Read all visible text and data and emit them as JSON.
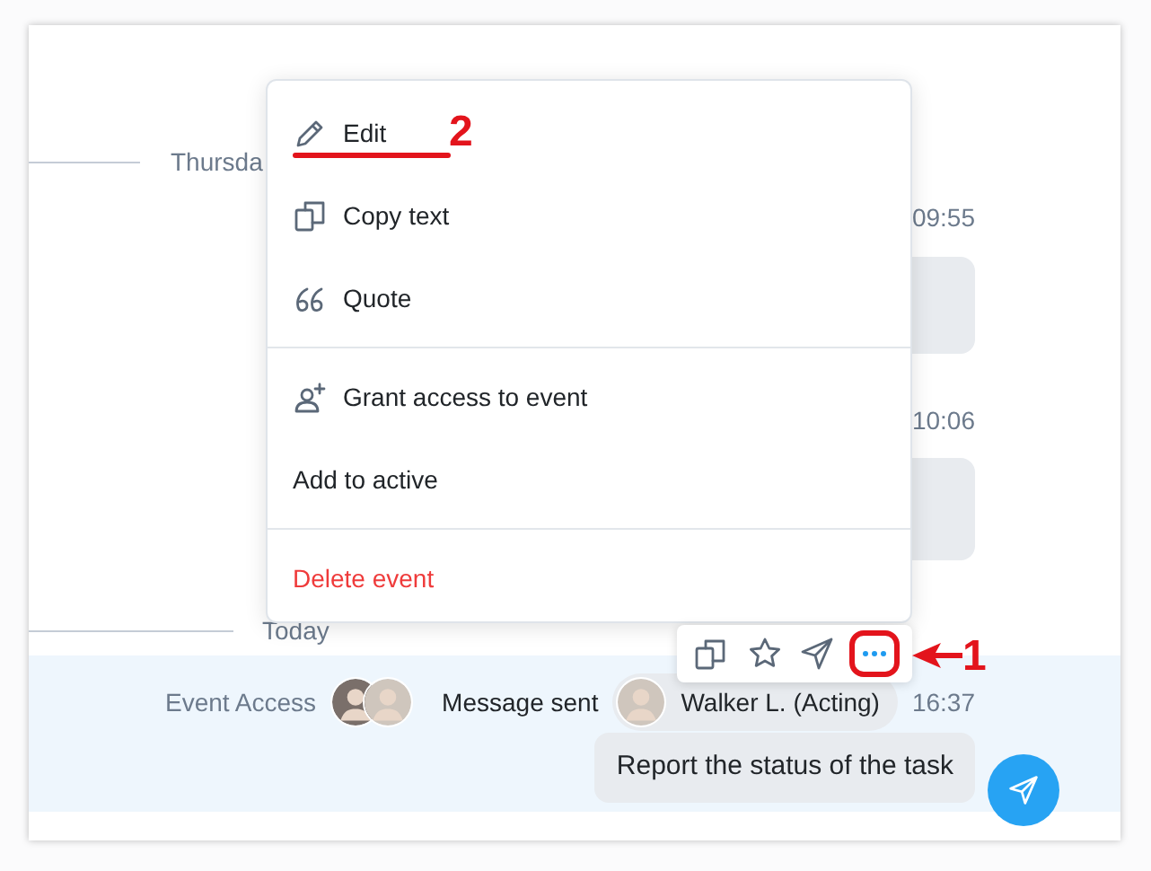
{
  "separators": [
    {
      "label": "Thursda"
    },
    {
      "label": "Today"
    }
  ],
  "messages": [
    {
      "time": "09:55"
    },
    {
      "time": "10:06"
    }
  ],
  "event": {
    "label": "Event Access",
    "action": "Message sent",
    "author": "Walker L. (Acting)",
    "time": "16:37",
    "text": "Report the status of the task"
  },
  "menu": [
    {
      "label": "Edit",
      "kind": "normal",
      "divider_before": false
    },
    {
      "label": "Copy text",
      "kind": "normal",
      "divider_before": false
    },
    {
      "label": "Quote",
      "kind": "normal",
      "divider_before": false
    },
    {
      "label": "Grant access to event",
      "kind": "normal",
      "divider_before": true
    },
    {
      "label": "Add to active",
      "kind": "normal",
      "divider_before": false
    },
    {
      "label": "Delete event",
      "kind": "danger",
      "divider_before": true
    }
  ],
  "toolbar": [
    {
      "selected": false
    },
    {
      "selected": false
    },
    {
      "selected": false
    },
    {
      "selected": true
    }
  ],
  "annotations": [
    {
      "label": "2"
    },
    {
      "label": "1"
    }
  ]
}
